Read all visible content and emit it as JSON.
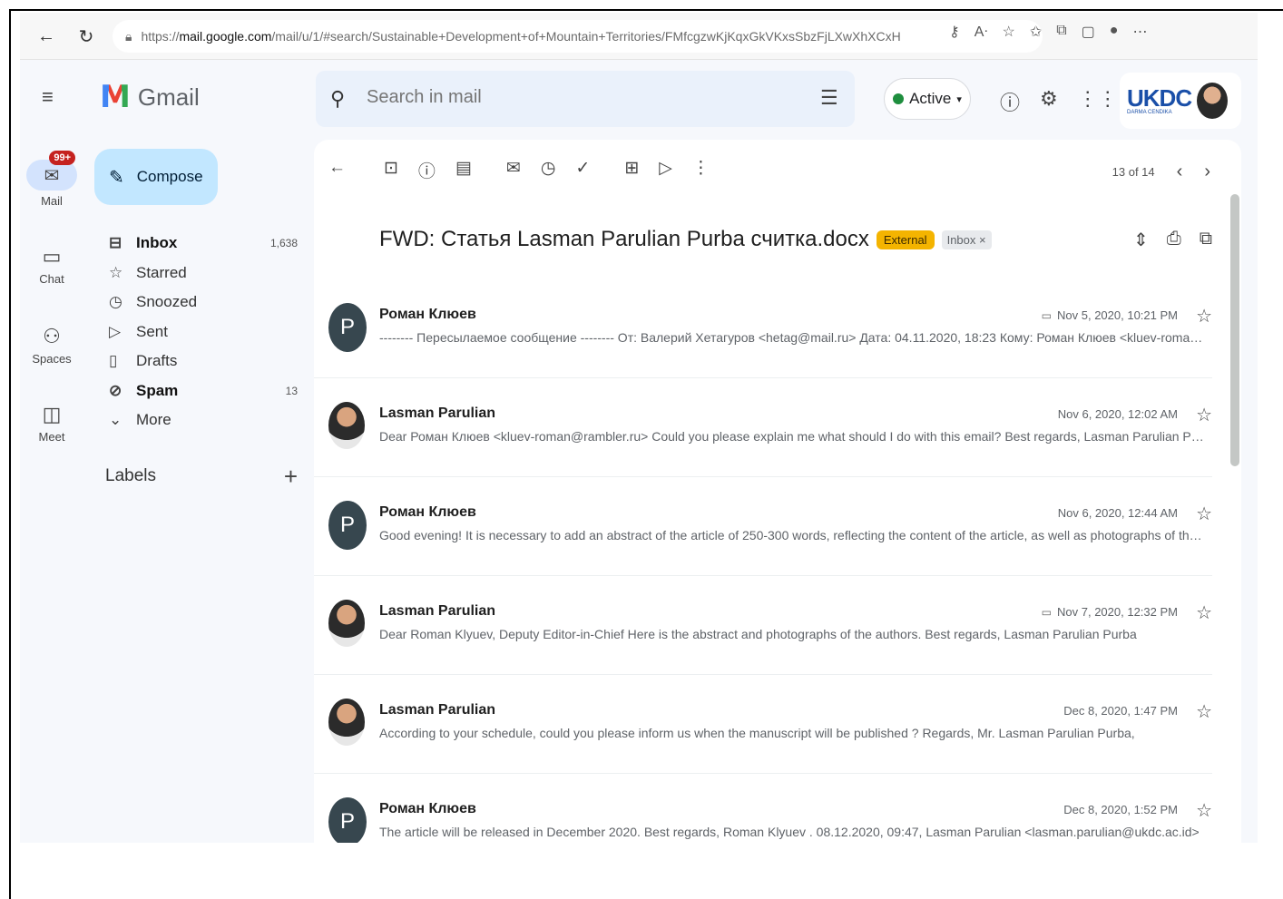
{
  "browser": {
    "url_prefix": "https://",
    "url_host": "mail.google.com",
    "url_path": "/mail/u/1/#search/Sustainable+Development+of+Mountain+Territories/FMfcgzwKjKqxGkVKxsSbzFjLXwXhXCxH"
  },
  "gmail": {
    "logo_text": "Gmail",
    "search_placeholder": "Search in mail",
    "status_label": "Active",
    "account_logo": "UKDC",
    "account_sub": "DARMA CENDIKA"
  },
  "rail": {
    "mail_label": "Mail",
    "mail_badge": "99+",
    "chat_label": "Chat",
    "spaces_label": "Spaces",
    "meet_label": "Meet"
  },
  "compose_label": "Compose",
  "nav": [
    {
      "label": "Inbox",
      "count": "1,638",
      "icon": "inbox-icon"
    },
    {
      "label": "Starred",
      "count": "",
      "icon": "star-icon"
    },
    {
      "label": "Snoozed",
      "count": "",
      "icon": "clock-icon"
    },
    {
      "label": "Sent",
      "count": "",
      "icon": "send-icon"
    },
    {
      "label": "Drafts",
      "count": "",
      "icon": "draft-icon"
    },
    {
      "label": "Spam",
      "count": "13",
      "icon": "spam-icon"
    },
    {
      "label": "More",
      "count": "",
      "icon": "chevron-down-icon"
    }
  ],
  "labels_title": "Labels",
  "pager_text": "13 of 14",
  "subject": {
    "title": "FWD: Статья Lasman Parulian Purba считка.docx",
    "tag_external": "External",
    "tag_inbox": "Inbox ×"
  },
  "messages": [
    {
      "sender": "Роман Клюев",
      "avatar": "P",
      "date": "Nov 5, 2020, 10:21 PM",
      "attach": true,
      "snippet": "-------- Пересылаемое сообщение -------- От: Валерий Хетагуров <hetag@mail.ru> Дата: 04.11.2020, 18:23 Кому: Роман Клюев <kluev-roman@rambler..."
    },
    {
      "sender": "Lasman Parulian",
      "avatar": "",
      "date": "Nov 6, 2020, 12:02 AM",
      "attach": false,
      "snippet": "Dear Роман Клюев <kluev-roman@rambler.ru> Could you please explain me what should I do with this email? Best regards, Lasman Parulian Purba"
    },
    {
      "sender": "Роман Клюев",
      "avatar": "P",
      "date": "Nov 6, 2020, 12:44 AM",
      "attach": false,
      "snippet": "Good evening! It is necessary to add an abstract of the article of 250-300 words, reflecting the content of the article, as well as photographs of the authors"
    },
    {
      "sender": "Lasman Parulian",
      "avatar": "",
      "date": "Nov 7, 2020, 12:32 PM",
      "attach": true,
      "snippet": "Dear Roman Klyuev, Deputy Editor-in-Chief Here is the abstract and photographs of the authors. Best regards, Lasman Parulian Purba"
    },
    {
      "sender": "Lasman Parulian",
      "avatar": "",
      "date": "Dec 8, 2020, 1:47 PM",
      "attach": false,
      "snippet": "According to your schedule, could you please inform us when the manuscript will be published ? Regards, Mr. Lasman Parulian Purba,"
    },
    {
      "sender": "Роман Клюев",
      "avatar": "P",
      "date": "Dec 8, 2020, 1:52 PM",
      "attach": false,
      "snippet": "The article will be released in December 2020. Best regards, Roman Klyuev . 08.12.2020, 09:47, Lasman Parulian <lasman.parulian@ukdc.ac.id>"
    }
  ]
}
